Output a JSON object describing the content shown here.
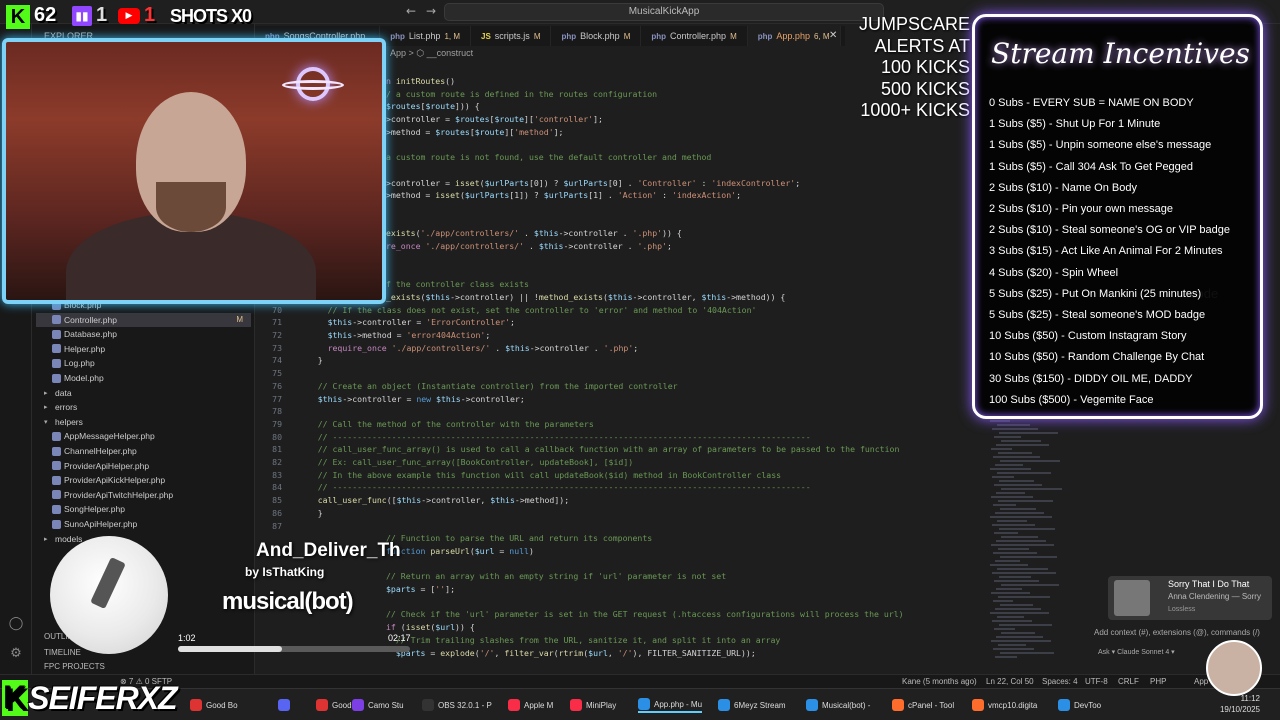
{
  "title_bar": {
    "search": "MusicalKickApp",
    "explorer": "EXPLORER"
  },
  "tabs": [
    {
      "label": "SongsController.php",
      "mod": "",
      "ext": "php",
      "active": false
    },
    {
      "label": "List.php",
      "mod": "1, M",
      "ext": "php",
      "active": false
    },
    {
      "label": "scripts.js",
      "mod": "M",
      "ext": "JS",
      "active": false
    },
    {
      "label": "Block.php",
      "mod": "M",
      "ext": "php",
      "active": false
    },
    {
      "label": "Controller.php",
      "mod": "M",
      "ext": "php",
      "active": false
    },
    {
      "label": "App.php",
      "mod": "6, M",
      "ext": "php",
      "active": true
    }
  ],
  "breadcrumb": "App  >  ⬡ __construct",
  "stream": {
    "kick_count": "62",
    "twitch_count": "1",
    "youtube_count": "1",
    "shots": "SHOTS X0",
    "jumpscare": [
      "JUMPSCARE",
      "ALERTS AT",
      "100 KICKS",
      "500 KICKS",
      "1000+ KICKS"
    ],
    "incentives_title": "Stream Incentives",
    "incentives": [
      "0 Subs - EVERY SUB = NAME ON BODY",
      "1 Subs ($5) - Shut Up For 1 Minute",
      "1 Subs ($5) - Unpin someone else's message",
      "1 Subs ($5) - Call 304 Ask To Get Pegged",
      "2 Subs ($10) - Name On Body",
      "2 Subs ($10) - Pin your own message",
      "2 Subs ($10) - Steal someone's OG or VIP badge",
      "3 Subs ($15) - Act Like An Animal For 2 Minutes",
      "4 Subs ($20) - Spin Wheel",
      "5 Subs ($25) - Put On Mankini (25 minutes)",
      "5 Subs ($25) - Steal someone's MOD badge",
      "10 Subs ($50) - Custom Instagram Story",
      "10 Subs ($50) - Random Challenge By Chat",
      "30 Subs ($150) - DIDDY OIL ME, DADDY",
      "100 Subs ($500) - Vegemite Face"
    ],
    "logo": "SEIFERXZ"
  },
  "now_playing": {
    "title": "And_Deliver_Th",
    "artist": "by IsThatKing",
    "brand": "musical(bot)",
    "elapsed": "1:02",
    "total": "02:17",
    "progress": 0.45
  },
  "sidebar": {
    "files": [
      {
        "label": "Block.php",
        "level": 2,
        "type": "file"
      },
      {
        "label": "Controller.php",
        "level": 2,
        "type": "file",
        "active": true,
        "badge": "M"
      },
      {
        "label": "Database.php",
        "level": 2,
        "type": "file"
      },
      {
        "label": "Helper.php",
        "level": 2,
        "type": "file"
      },
      {
        "label": "Log.php",
        "level": 2,
        "type": "file"
      },
      {
        "label": "Model.php",
        "level": 2,
        "type": "file"
      },
      {
        "label": "data",
        "level": 1,
        "type": "folder"
      },
      {
        "label": "errors",
        "level": 1,
        "type": "folder"
      },
      {
        "label": "helpers",
        "level": 1,
        "type": "folder-open"
      },
      {
        "label": "AppMessageHelper.php",
        "level": 2,
        "type": "file"
      },
      {
        "label": "ChannelHelper.php",
        "level": 2,
        "type": "file"
      },
      {
        "label": "ProviderApiHelper.php",
        "level": 2,
        "type": "file"
      },
      {
        "label": "ProviderApiKickHelper.php",
        "level": 2,
        "type": "file"
      },
      {
        "label": "ProviderApiTwitchHelper.php",
        "level": 2,
        "type": "file"
      },
      {
        "label": "SongHelper.php",
        "level": 2,
        "type": "file"
      },
      {
        "label": "SunoApiHelper.php",
        "level": 2,
        "type": "file"
      },
      {
        "label": "models",
        "level": 1,
        "type": "folder"
      }
    ],
    "outline": "OUTLINE",
    "timeline": "TIMELINE",
    "fpc_projects": "FPC PROJECTS"
  },
  "code": [
    {
      "ln": "",
      "parts": [
        [
          "kw",
          "n "
        ],
        [
          "fn",
          "initRoutes"
        ],
        [
          "plain",
          "()"
        ]
      ]
    },
    {
      "ln": "",
      "parts": [
        [
          "com",
          "/ a custom route is defined in the routes configuration"
        ]
      ]
    },
    {
      "ln": "",
      "parts": [
        [
          "var",
          "$routes"
        ],
        [
          "plain",
          "["
        ],
        [
          "var",
          "$route"
        ],
        [
          "plain",
          "])) {"
        ]
      ]
    },
    {
      "ln": "",
      "parts": [
        [
          "plain",
          ">controller = "
        ],
        [
          "var",
          "$routes"
        ],
        [
          "plain",
          "["
        ],
        [
          "var",
          "$route"
        ],
        [
          "plain",
          "]["
        ],
        [
          "str",
          "'controller'"
        ],
        [
          "plain",
          "];"
        ]
      ]
    },
    {
      "ln": "",
      "parts": [
        [
          "plain",
          ">method = "
        ],
        [
          "var",
          "$routes"
        ],
        [
          "plain",
          "["
        ],
        [
          "var",
          "$route"
        ],
        [
          "plain",
          "]["
        ],
        [
          "str",
          "'method'"
        ],
        [
          "plain",
          "];"
        ]
      ]
    },
    {
      "ln": "",
      "parts": [
        [
          "plain",
          ""
        ]
      ]
    },
    {
      "ln": "",
      "parts": [
        [
          "com",
          "a custom route is not found, use the default controller and method"
        ]
      ]
    },
    {
      "ln": "",
      "parts": [
        [
          "plain",
          ""
        ]
      ]
    },
    {
      "ln": "",
      "parts": [
        [
          "plain",
          ">controller = "
        ],
        [
          "fn",
          "isset"
        ],
        [
          "plain",
          "("
        ],
        [
          "var",
          "$urlParts"
        ],
        [
          "plain",
          "[0]) ? "
        ],
        [
          "var",
          "$urlParts"
        ],
        [
          "plain",
          "[0] . "
        ],
        [
          "str",
          "'Controller'"
        ],
        [
          "plain",
          " : "
        ],
        [
          "str",
          "'indexController'"
        ],
        [
          "plain",
          ";"
        ]
      ]
    },
    {
      "ln": "",
      "parts": [
        [
          "plain",
          ">method = "
        ],
        [
          "fn",
          "isset"
        ],
        [
          "plain",
          "("
        ],
        [
          "var",
          "$urlParts"
        ],
        [
          "plain",
          "[1]) ? "
        ],
        [
          "var",
          "$urlParts"
        ],
        [
          "plain",
          "[1] . "
        ],
        [
          "str",
          "'Action'"
        ],
        [
          "plain",
          " : "
        ],
        [
          "str",
          "'indexAction'"
        ],
        [
          "plain",
          ";"
        ]
      ]
    },
    {
      "ln": "",
      "parts": [
        [
          "plain",
          ""
        ]
      ]
    },
    {
      "ln": "",
      "parts": [
        [
          "plain",
          ""
        ]
      ]
    },
    {
      "ln": "",
      "parts": [
        [
          "fn",
          "exists"
        ],
        [
          "plain",
          "("
        ],
        [
          "str",
          "'./app/controllers/'"
        ],
        [
          "plain",
          " . "
        ],
        [
          "var",
          "$this"
        ],
        [
          "plain",
          "->controller . "
        ],
        [
          "str",
          "'.php'"
        ],
        [
          "plain",
          ")) {"
        ]
      ]
    },
    {
      "ln": "",
      "parts": [
        [
          "kw",
          "re_once "
        ],
        [
          "str",
          "'./app/controllers/'"
        ],
        [
          "plain",
          " . "
        ],
        [
          "var",
          "$this"
        ],
        [
          "plain",
          "->controller . "
        ],
        [
          "str",
          "'.php'"
        ],
        [
          "plain",
          ";"
        ]
      ]
    },
    {
      "ln": "",
      "parts": [
        [
          "plain",
          ""
        ]
      ]
    },
    {
      "ln": "",
      "parts": [
        [
          "plain",
          ""
        ]
      ]
    },
    {
      "ln": "",
      "parts": [
        [
          "com",
          "f the controller class exists"
        ]
      ]
    },
    {
      "ln": "",
      "parts": [
        [
          "fn",
          "_exists"
        ],
        [
          "plain",
          "("
        ],
        [
          "var",
          "$this"
        ],
        [
          "plain",
          "->controller) || !"
        ],
        [
          "fn",
          "method_exists"
        ],
        [
          "plain",
          "("
        ],
        [
          "var",
          "$this"
        ],
        [
          "plain",
          "->controller, "
        ],
        [
          "var",
          "$this"
        ],
        [
          "plain",
          "->method)) {"
        ]
      ]
    },
    {
      "ln": "70",
      "parts": [
        [
          "com",
          "  // If the class does not exist, set the controller to 'error' and method to '404Action'"
        ]
      ]
    },
    {
      "ln": "71",
      "parts": [
        [
          "var",
          "  $this"
        ],
        [
          "plain",
          "->controller = "
        ],
        [
          "str",
          "'ErrorController'"
        ],
        [
          "plain",
          ";"
        ]
      ]
    },
    {
      "ln": "72",
      "parts": [
        [
          "var",
          "  $this"
        ],
        [
          "plain",
          "->method = "
        ],
        [
          "str",
          "'error404Action'"
        ],
        [
          "plain",
          ";"
        ]
      ]
    },
    {
      "ln": "73",
      "parts": [
        [
          "kw",
          "  require_once "
        ],
        [
          "str",
          "'./app/controllers/'"
        ],
        [
          "plain",
          " . "
        ],
        [
          "var",
          "$this"
        ],
        [
          "plain",
          "->controller . "
        ],
        [
          "str",
          "'.php'"
        ],
        [
          "plain",
          ";"
        ]
      ]
    },
    {
      "ln": "74",
      "parts": [
        [
          "plain",
          "}"
        ]
      ]
    },
    {
      "ln": "75",
      "parts": [
        [
          "plain",
          ""
        ]
      ]
    },
    {
      "ln": "76",
      "parts": [
        [
          "com",
          "// Create an object (Instantiate controller) from the imported controller"
        ]
      ]
    },
    {
      "ln": "77",
      "parts": [
        [
          "var",
          "$this"
        ],
        [
          "plain",
          "->controller = "
        ],
        [
          "blue",
          "new "
        ],
        [
          "var",
          "$this"
        ],
        [
          "plain",
          "->controller;"
        ]
      ]
    },
    {
      "ln": "78",
      "parts": [
        [
          "plain",
          ""
        ]
      ]
    },
    {
      "ln": "79",
      "parts": [
        [
          "com",
          "// Call the method of the controller with the parameters"
        ]
      ]
    },
    {
      "ln": "80",
      "parts": [
        [
          "com",
          "// -------------------------------------------------------------------------------------------------"
        ]
      ]
    },
    {
      "ln": "81",
      "parts": [
        [
          "com",
          "// call_user_func_array() is used to call a callback function with an array of parameters to be passed to the function"
        ]
      ]
    },
    {
      "ln": "82",
      "parts": [
        [
          "com",
          "// Ex: call_user_func_array([BookController, updateBook], [$id])"
        ]
      ]
    },
    {
      "ln": "83",
      "parts": [
        [
          "com",
          "// In the above example this function will call updateBook($id) method in BookController class"
        ]
      ]
    },
    {
      "ln": "84",
      "parts": [
        [
          "com",
          "// -------------------------------------------------------------------------------------------------"
        ]
      ]
    },
    {
      "ln": "85",
      "parts": [
        [
          "fn",
          "call_user_func"
        ],
        [
          "plain",
          "(["
        ],
        [
          "var",
          "$this"
        ],
        [
          "plain",
          "->controller, "
        ],
        [
          "var",
          "$this"
        ],
        [
          "plain",
          "->method]);"
        ]
      ]
    },
    {
      "ln": "86",
      "parts": [
        [
          "plain",
          "}"
        ]
      ]
    },
    {
      "ln": "87",
      "parts": [
        [
          "plain",
          ""
        ]
      ]
    },
    {
      "ln": "",
      "parts": [
        [
          "com",
          "// Function to parse the URL and return its components"
        ]
      ]
    },
    {
      "ln": "",
      "parts": [
        [
          "blue",
          "function "
        ],
        [
          "fn",
          "parseUrl"
        ],
        [
          "plain",
          "("
        ],
        [
          "var",
          "$url"
        ],
        [
          "plain",
          " = "
        ],
        [
          "blue",
          "null"
        ],
        [
          "plain",
          ")"
        ]
      ]
    },
    {
      "ln": "",
      "parts": [
        [
          "plain",
          ""
        ]
      ]
    },
    {
      "ln": "",
      "parts": [
        [
          "com",
          "// Return an array with an empty string if 'url' parameter is not set"
        ]
      ]
    },
    {
      "ln": "",
      "parts": [
        [
          "var",
          "$parts"
        ],
        [
          "plain",
          " = ["
        ],
        [
          "str",
          "''"
        ],
        [
          "plain",
          "];"
        ]
      ]
    },
    {
      "ln": "",
      "parts": [
        [
          "plain",
          ""
        ]
      ]
    },
    {
      "ln": "",
      "parts": [
        [
          "com",
          "// Check if the 'url' parameter is set in the GET request (.htaccess configurations will process the url)"
        ]
      ]
    },
    {
      "ln": "",
      "parts": [
        [
          "kw",
          "if "
        ],
        [
          "plain",
          "("
        ],
        [
          "fn",
          "isset"
        ],
        [
          "plain",
          "("
        ],
        [
          "var",
          "$url"
        ],
        [
          "plain",
          ")) {"
        ]
      ]
    },
    {
      "ln": "",
      "parts": [
        [
          "com",
          "  // Trim trailing slashes from the URL, sanitize it, and split it into an array"
        ]
      ]
    },
    {
      "ln": "",
      "parts": [
        [
          "var",
          "  $parts"
        ],
        [
          "plain",
          " = "
        ],
        [
          "fn",
          "explode"
        ],
        [
          "plain",
          "("
        ],
        [
          "str",
          "'/'"
        ],
        [
          "plain",
          ", "
        ],
        [
          "fn",
          "filter_var"
        ],
        [
          "plain",
          "("
        ],
        [
          "fn",
          "rtrim"
        ],
        [
          "plain",
          "("
        ],
        [
          "var",
          "$url"
        ],
        [
          "plain",
          ", "
        ],
        [
          "str",
          "'/'"
        ],
        [
          "plain",
          "), FILTER_SANITIZE_URL));"
        ]
      ]
    }
  ],
  "statusbar": {
    "left": "⊗ 7 ⚠ 0   SFTP",
    "blame": "Kane (5 months ago)",
    "position": "Ln 22, Col 50",
    "spaces": "Spaces: 4",
    "encoding": "UTF-8",
    "eol": "CRLF",
    "lang": "PHP",
    "app": "App"
  },
  "taskbar": [
    {
      "label": "Good Bo",
      "color": "#d33"
    },
    {
      "label": "",
      "color": "#5865f2"
    },
    {
      "label": "Good B",
      "color": "#d33"
    },
    {
      "label": "Camo Stu",
      "color": "#7b3fe4"
    },
    {
      "label": "OBS 32.0.1 - P",
      "color": "#333"
    },
    {
      "label": "Apple M",
      "color": "#fa2d48"
    },
    {
      "label": "MiniPlay",
      "color": "#fa2d48"
    },
    {
      "label": "App.php - Mu",
      "color": "#2b8fe6",
      "active": true
    },
    {
      "label": "6Meyz Stream",
      "color": "#2b8fe6"
    },
    {
      "label": "Musical(bot) -",
      "color": "#2b8fe6"
    },
    {
      "label": "cPanel - Tool",
      "color": "#ff6c2c"
    },
    {
      "label": "vmcp10.digita",
      "color": "#ff6c2c"
    },
    {
      "label": "DevToo",
      "color": "#2b8fe6"
    }
  ],
  "clock": {
    "time": "11:12",
    "date": "19/10/2025"
  },
  "notification": {
    "title": "Sorry That I Do That",
    "artist": "Anna Clendening — Sorry",
    "tag": "Lossless"
  },
  "copilot": {
    "input_placeholder": "Add context (#), extensions (@), commands (/)",
    "agent": "Ask ▾   Claude Sonnet 4 ▾",
    "ghost": "code"
  }
}
